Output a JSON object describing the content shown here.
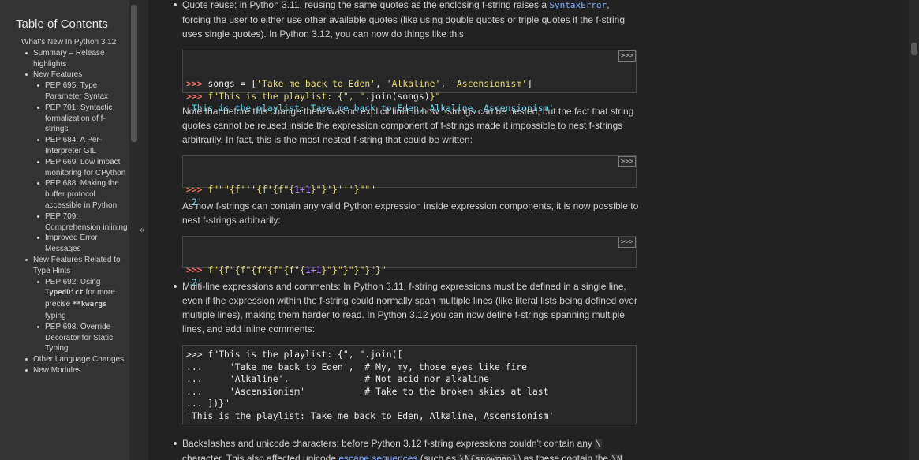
{
  "toc": {
    "title": "Table of Contents",
    "items": [
      {
        "label": "What's New In Python 3.12",
        "level": 0
      },
      {
        "label": "Summary – Release highlights",
        "level": 1
      },
      {
        "label": "New Features",
        "level": 1
      },
      {
        "label": "PEP 695: Type Parameter Syntax",
        "level": 2
      },
      {
        "label": "PEP 701: Syntactic formalization of f-strings",
        "level": 2
      },
      {
        "label": "PEP 684: A Per-Interpreter GIL",
        "level": 2
      },
      {
        "label": "PEP 669: Low impact monitoring for CPython",
        "level": 2
      },
      {
        "label": "PEP 688: Making the buffer protocol accessible in Python",
        "level": 2
      },
      {
        "label": "PEP 709: Comprehension inlining",
        "level": 2
      },
      {
        "label": "Improved Error Messages",
        "level": 2
      },
      {
        "label": "New Features Related to Type Hints",
        "level": 1
      },
      {
        "label_pre": "PEP 692: Using ",
        "label_mono": "TypedDict",
        "label_post": " for more precise ",
        "label_mono2": "**kwargs",
        "label_post2": " typing",
        "level": 2
      },
      {
        "label": "PEP 698: Override Decorator for Static Typing",
        "level": 2
      },
      {
        "label": "Other Language Changes",
        "level": 1
      },
      {
        "label": "New Modules",
        "level": 1
      }
    ],
    "collapse_glyph": "«"
  },
  "content": {
    "p1_pre": "Quote reuse: in Python 3.11, reusing the same quotes as the enclosing f-string raises a ",
    "p1_code": "SyntaxError",
    "p1_post": ", forcing the user to either use other available quotes (like using double quotes or triple quotes if the f-string uses single quotes). In Python 3.12, you can now do things like this:",
    "copy_label": ">>>",
    "code1": {
      "l1_prompt": ">>> ",
      "l1_a": "songs = [",
      "l1_s1": "'Take me back to Eden'",
      "l1_c1": ", ",
      "l1_s2": "'Alkaline'",
      "l1_c2": ", ",
      "l1_s3": "'Ascensionism'",
      "l1_end": "]",
      "l2_prompt": ">>> ",
      "l2_s1": "f\"This is the playlist: {",
      "l2_s2": "\", \"",
      "l2_mid": ".join(songs)",
      "l2_s3": "}\"",
      "l3_out": "'This is the playlist: Take me back to Eden, Alkaline, Ascensionism'"
    },
    "p2": "Note that before this change there was no explicit limit in how f-strings can be nested, but the fact that string quotes cannot be reused inside the expression component of f-strings made it impossible to nest f-strings arbitrarily. In fact, this is the most nested f-string that could be written:",
    "code2": {
      "prompt": ">>> ",
      "s_a": "f\"\"\"{f'''{f'{f\"{",
      "n": "1+1",
      "s_b": "}\"}'}'''}\"\"\"",
      "out": "'2'"
    },
    "p3": "As now f-strings can contain any valid Python expression inside expression components, it is now possible to nest f-strings arbitrarily:",
    "code3": {
      "prompt": ">>> ",
      "s_a": "f\"{f\"{f\"{f\"{f\"{f\"{",
      "n": "1+1",
      "s_b": "}\"}\"}\"}\"}\"}\"",
      "out": "'2'"
    },
    "p4": "Multi-line expressions and comments: In Python 3.11, f-string expressions must be defined in a single line, even if the expression within the f-string could normally span multiple lines (like literal lists being defined over multiple lines), making them harder to read. In Python 3.12 you can now define f-strings spanning multiple lines, and add inline comments:",
    "code4": {
      "lines": [
        ">>> f\"This is the playlist: {\", \".join([",
        "...     'Take me back to Eden',  # My, my, those eyes like fire",
        "...     'Alkaline',              # Not acid nor alkaline",
        "...     'Ascensionism'           # Take to the broken skies at last",
        "... ])}\"",
        "'This is the playlist: Take me back to Eden, Alkaline, Ascensionism'"
      ]
    },
    "p5_pre": "Backslashes and unicode characters: before Python 3.12 f-string expressions couldn't contain any ",
    "p5_code1": "\\",
    "p5_mid": " character. This also affected unicode ",
    "p5_link": "escape sequences",
    "p5_mid2": " (such as ",
    "p5_code2": "\\N{snowman}",
    "p5_post": ") as these contain the ",
    "p5_code3": "\\N"
  }
}
